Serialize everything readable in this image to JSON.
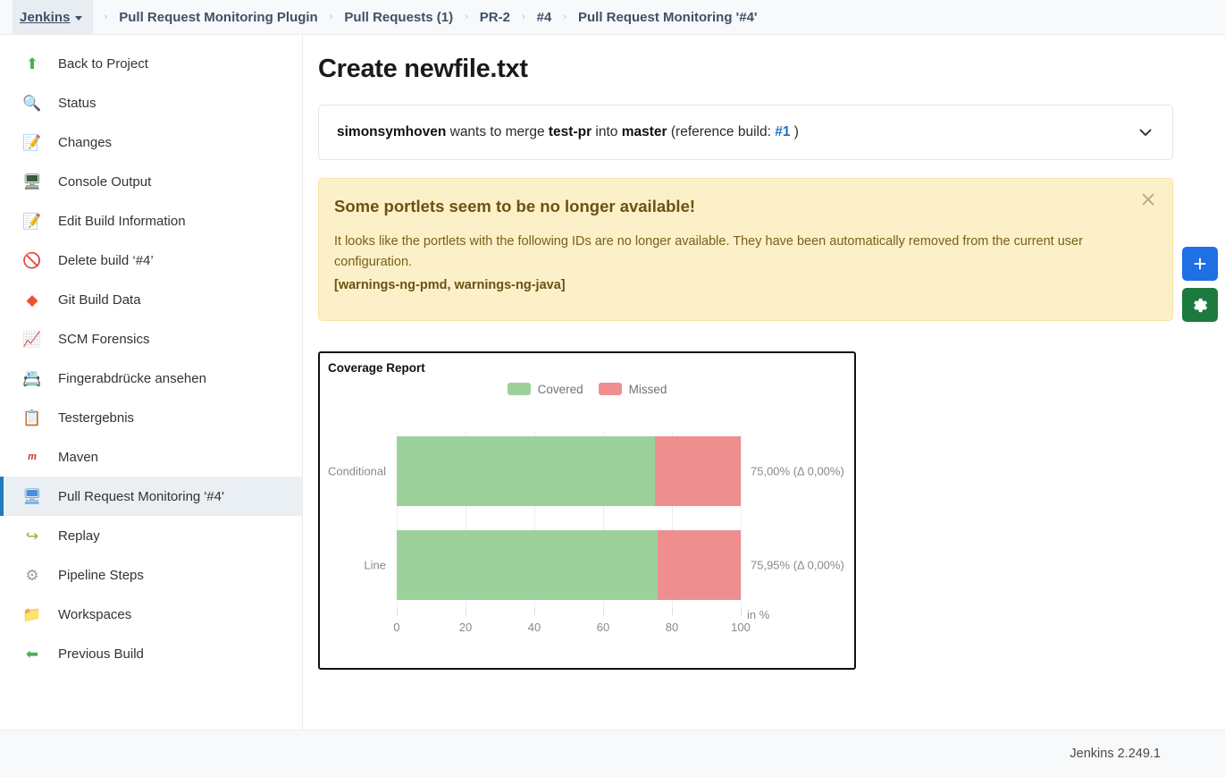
{
  "breadcrumb": {
    "root_label": "Jenkins",
    "separator": "›",
    "items": [
      {
        "label": "Pull Request Monitoring Plugin"
      },
      {
        "label": "Pull Requests (1)"
      },
      {
        "label": "PR-2"
      },
      {
        "label": "#4"
      },
      {
        "label": "Pull Request Monitoring '#4'"
      }
    ]
  },
  "sidebar": {
    "items": [
      {
        "label": "Back to Project",
        "icon": "up-arrow-icon",
        "glyph": "⬆",
        "color": "#4caf50",
        "active": false
      },
      {
        "label": "Status",
        "icon": "magnifier-icon",
        "glyph": "🔍",
        "color": "#5a8fd6",
        "active": false
      },
      {
        "label": "Changes",
        "icon": "notepad-pencil-icon",
        "glyph": "📝",
        "color": "#c8a02a",
        "active": false
      },
      {
        "label": "Console Output",
        "icon": "terminal-icon",
        "glyph": "🖥",
        "color": "#3c5a3c",
        "active": false
      },
      {
        "label": "Edit Build Information",
        "icon": "notepad-pencil-icon",
        "glyph": "📝",
        "color": "#c8a02a",
        "active": false
      },
      {
        "label": "Delete build ‘#4’",
        "icon": "no-entry-icon",
        "glyph": "🚫",
        "color": "#e03131",
        "active": false
      },
      {
        "label": "Git Build Data",
        "icon": "git-icon",
        "glyph": "◆",
        "color": "#f05133",
        "active": false
      },
      {
        "label": "SCM Forensics",
        "icon": "line-chart-icon",
        "glyph": "📈",
        "color": "#7a7a7a",
        "active": false
      },
      {
        "label": "Fingerabdrücke ansehen",
        "icon": "fingerprint-card-icon",
        "glyph": "📇",
        "color": "#8a8a6a",
        "active": false
      },
      {
        "label": "Testergebnis",
        "icon": "clipboard-icon",
        "glyph": "📋",
        "color": "#b07b2a",
        "active": false
      },
      {
        "label": "Maven",
        "icon": "maven-icon",
        "glyph": "m",
        "color": "#c9302c",
        "active": false
      },
      {
        "label": "Pull Request Monitoring '#4'",
        "icon": "monitor-icon",
        "glyph": "🖥",
        "color": "#4a90d9",
        "active": true
      },
      {
        "label": "Replay",
        "icon": "replay-arrow-icon",
        "glyph": "↪",
        "color": "#8cb22e",
        "active": false
      },
      {
        "label": "Pipeline Steps",
        "icon": "gear-icon",
        "glyph": "⚙",
        "color": "#9aa0a6",
        "active": false
      },
      {
        "label": "Workspaces",
        "icon": "folder-icon",
        "glyph": "📁",
        "color": "#4a90d9",
        "active": false
      },
      {
        "label": "Previous Build",
        "icon": "left-arrow-icon",
        "glyph": "⬅",
        "color": "#4caf50",
        "active": false
      }
    ]
  },
  "main": {
    "page_title": "Create newfile.txt",
    "pull_request": {
      "author": "simonsymhoven",
      "mid_text_1": " wants to merge ",
      "source_branch": "test-pr",
      "mid_text_2": " into ",
      "target_branch": "master",
      "reference_prefix": " (reference build: ",
      "reference_build": "#1",
      "reference_suffix": " )",
      "toggle_icon": "chevron-down-icon"
    },
    "alert": {
      "title": "Some portlets seem to be no longer available!",
      "body": "It looks like the portlets with the following IDs are no longer available. They have been automatically removed from the current user configuration.",
      "ids": "[warnings-ng-pmd, warnings-ng-java]",
      "close_icon": "close-icon"
    }
  },
  "chart_data": {
    "type": "bar",
    "title": "Coverage Report",
    "orientation": "horizontal",
    "stacked": true,
    "xlabel": "in %",
    "ylabel": "",
    "xlim": [
      0,
      100
    ],
    "xticks": [
      0,
      20,
      40,
      60,
      80,
      100
    ],
    "xtick_labels": [
      "0",
      "20",
      "40",
      "60",
      "80",
      "100"
    ],
    "categories": [
      "Conditional",
      "Line"
    ],
    "grid": true,
    "legend_position": "top-center",
    "series": [
      {
        "name": "Covered",
        "color": "#9cd19c",
        "values": [
          75.0,
          75.95
        ]
      },
      {
        "name": "Missed",
        "color": "#ef8e8e",
        "values": [
          25.0,
          24.05
        ]
      }
    ],
    "data_labels": [
      "75,00% (Δ 0,00%)",
      "75,95% (Δ 0,00%)"
    ]
  },
  "fabs": {
    "add": {
      "label": "+",
      "icon": "plus-icon",
      "color": "#1f6fe5"
    },
    "config": {
      "label": "⚙",
      "icon": "gear-icon",
      "color": "#1d7a3e"
    }
  },
  "footer": {
    "version": "Jenkins 2.249.1"
  }
}
